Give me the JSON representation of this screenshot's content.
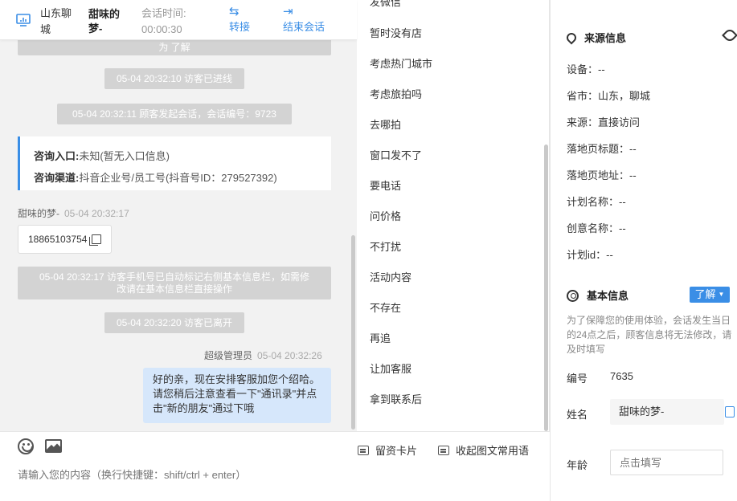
{
  "header": {
    "city": "山东聊城",
    "visitor_name": "甜味的梦-",
    "time_label": "会话时间:",
    "time_value": "00:00:30",
    "transfer_label": "转接",
    "end_label": "结束会话"
  },
  "chat": {
    "clipped_top": "为 了解",
    "sys_entered": "05-04 20:32:10 访客已进线",
    "sys_started": "05-04 20:32:11 顾客发起会话，会话编号：9723",
    "entry_label": "咨询入口:",
    "entry_value": "未知(暂无入口信息)",
    "channel_label": "咨询渠道:",
    "channel_value": "抖音企业号/员工号(抖音号ID：279527392)",
    "visitor_sender": "甜味的梦-",
    "visitor_time": "05-04 20:32:17",
    "phone": "18865103754",
    "sys_phone_line1": "05-04 20:32:17 访客手机号已自动标记右侧基本信息栏，如需修",
    "sys_phone_line2": "改请在基本信息栏直接操作",
    "sys_left": "05-04 20:32:20 访客已离开",
    "agent_sender": "超级管理员",
    "agent_time": "05-04 20:32:26",
    "agent_msg_line1": "好的亲，现在安排客服加您个绍哈。",
    "agent_msg_line2": "请您稍后注意查看一下\"通讯录\"并点",
    "agent_msg_line3": "击\"新的朋友\"通过下哦"
  },
  "composer": {
    "placeholder": "请输入您的内容（换行快捷键：shift/ctrl + enter）",
    "card_label": "留资卡片",
    "collapse_label": "收起图文常用语"
  },
  "phrases": [
    "发微信",
    "暂时没有店",
    "考虑热门城市",
    "考虑旅拍吗",
    "去哪拍",
    "窗口发不了",
    "要电话",
    "问价格",
    "不打扰",
    "活动内容",
    "不存在",
    "再追",
    "让加客服",
    "拿到联系后"
  ],
  "source": {
    "title": "来源信息",
    "device": "设备：--",
    "province": "省市：山东，聊城",
    "origin": "来源：直接访问",
    "landing_title": "落地页标题：--",
    "landing_url": "落地页地址：--",
    "plan_name": "计划名称：--",
    "creative_name": "创意名称：--",
    "plan_id": "计划id：--"
  },
  "basic": {
    "title": "基本信息",
    "learn_label": "了解",
    "notice": "为了保障您的使用体验，会话发生当日的24点之后，顾客信息将无法修改，请及时填写",
    "number_label": "编号",
    "number_value": "7635",
    "name_label": "姓名",
    "name_value": "甜味的梦-",
    "age_label": "年龄",
    "age_placeholder": "点击填写"
  }
}
